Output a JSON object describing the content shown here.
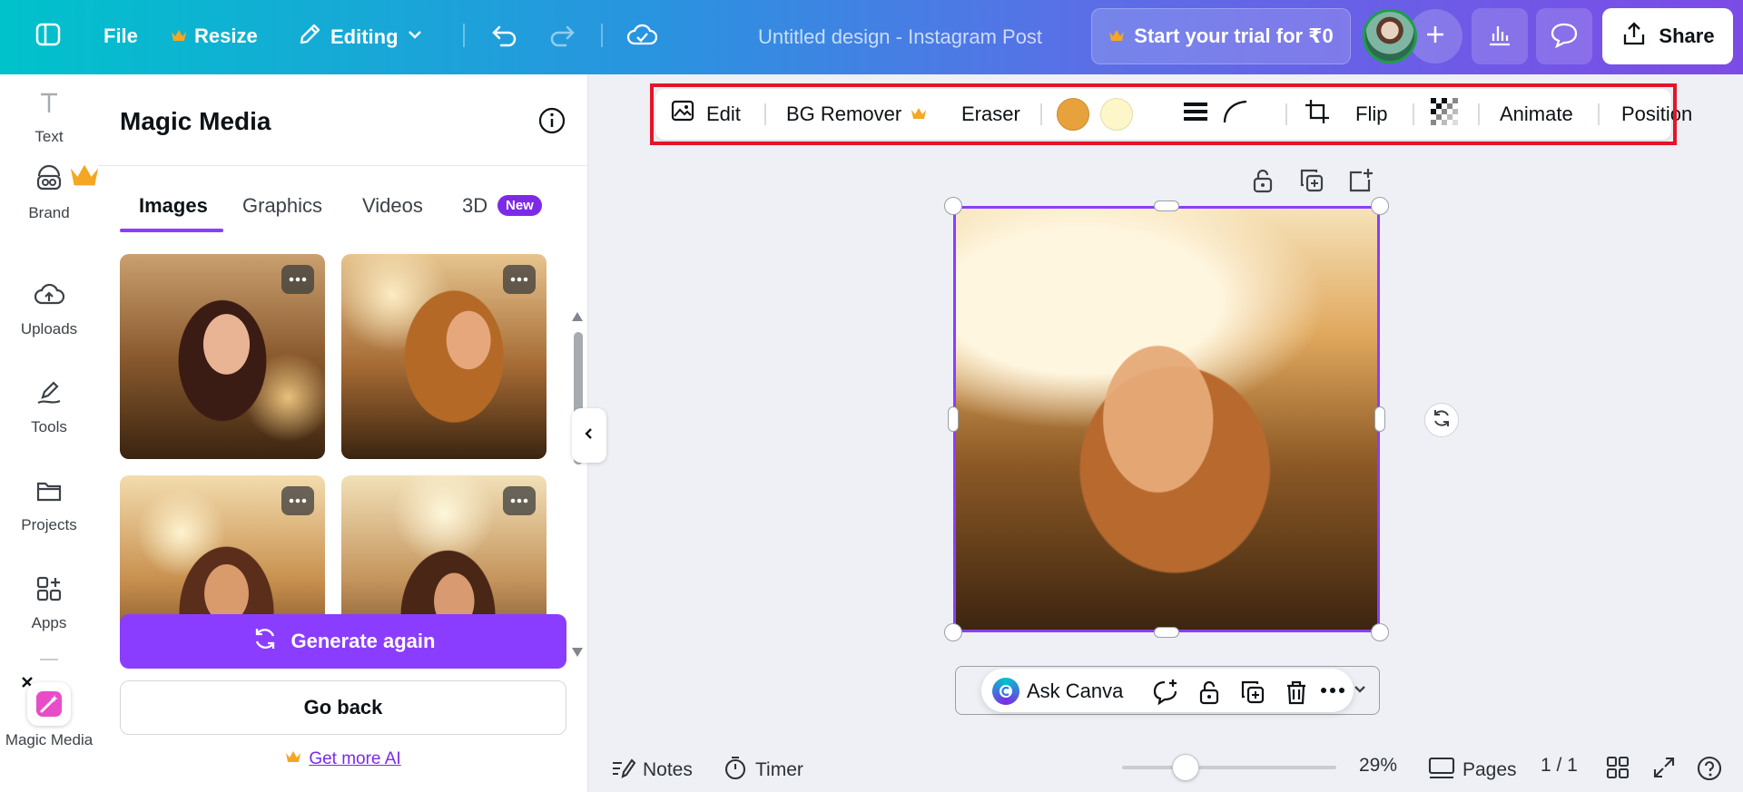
{
  "topbar": {
    "file_label": "File",
    "resize_label": "Resize",
    "editing_label": "Editing",
    "doc_title": "Untitled design - Instagram Post",
    "trial_label": "Start your trial for ₹0",
    "share_label": "Share"
  },
  "rail": {
    "items": [
      {
        "label": "Text",
        "icon": "text-icon"
      },
      {
        "label": "Brand",
        "icon": "brand-icon"
      },
      {
        "label": "Uploads",
        "icon": "cloud-upload-icon"
      },
      {
        "label": "Tools",
        "icon": "pen-tool-icon"
      },
      {
        "label": "Projects",
        "icon": "folder-icon"
      },
      {
        "label": "Apps",
        "icon": "apps-grid-icon"
      },
      {
        "label": "Magic Media",
        "icon": "magic-media-icon"
      }
    ]
  },
  "panel": {
    "title": "Magic Media",
    "tabs": [
      "Images",
      "Graphics",
      "Videos",
      "3D"
    ],
    "active_tab": "Images",
    "new_badge": "New",
    "generate_label": "Generate again",
    "back_label": "Go back",
    "more_ai_label": "Get more AI"
  },
  "toolbar": {
    "edit_label": "Edit",
    "bg_remover_label": "BG Remover",
    "eraser_label": "Eraser",
    "flip_label": "Flip",
    "animate_label": "Animate",
    "position_label": "Position",
    "swatches": [
      "#e8a23c",
      "#fdf6c8"
    ]
  },
  "ask": {
    "label": "Ask Canva"
  },
  "bottom": {
    "notes_label": "Notes",
    "timer_label": "Timer",
    "zoom_label": "29%",
    "pages_label": "Pages",
    "page_count": "1 / 1"
  },
  "colors": {
    "accent": "#8b3dff",
    "highlight": "#e3152a",
    "crown": "#f5a623"
  }
}
